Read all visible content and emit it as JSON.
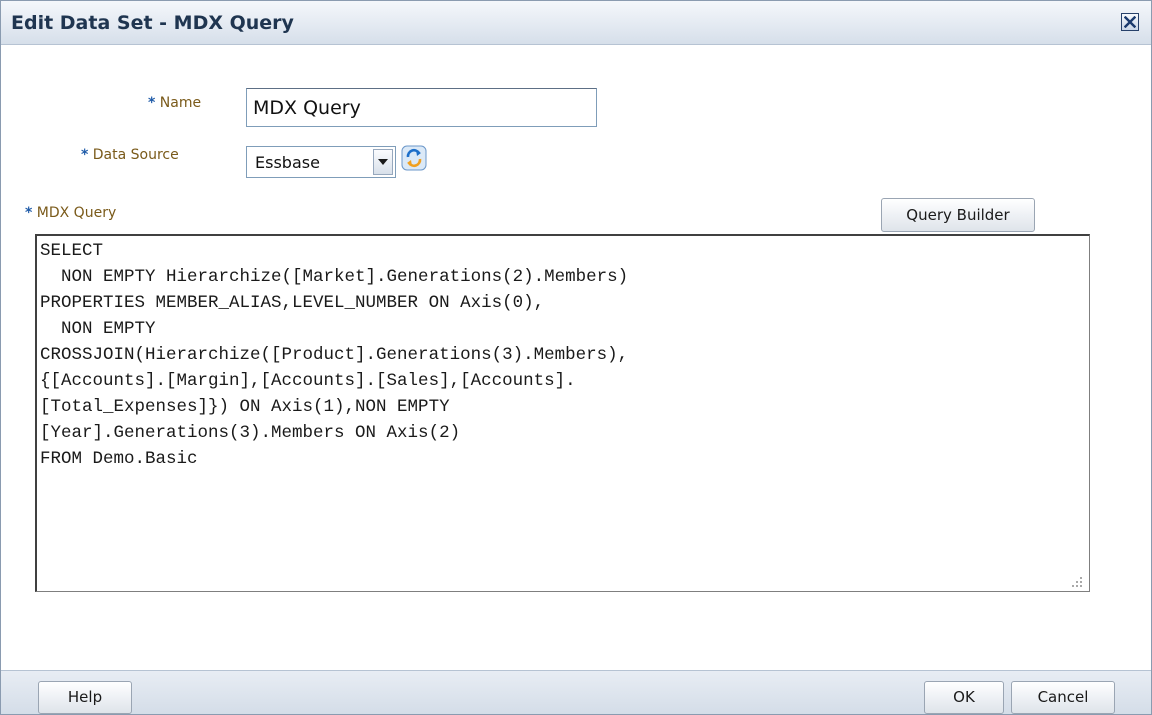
{
  "dialog": {
    "title": "Edit Data Set - MDX Query",
    "close_icon": "close-icon"
  },
  "form": {
    "required_marker": "*",
    "name_label": "Name",
    "name_value": "MDX Query",
    "data_source_label": "Data Source",
    "data_source_value": "Essbase",
    "refresh_icon": "refresh-icon",
    "mdx_query_label": "MDX Query",
    "query_builder_label": "Query Builder",
    "query_text": "SELECT\n  NON EMPTY Hierarchize([Market].Generations(2).Members)\nPROPERTIES MEMBER_ALIAS,LEVEL_NUMBER ON Axis(0),\n  NON EMPTY\nCROSSJOIN(Hierarchize([Product].Generations(3).Members),\n{[Accounts].[Margin],[Accounts].[Sales],[Accounts].\n[Total_Expenses]}) ON Axis(1),NON EMPTY\n[Year].Generations(3).Members ON Axis(2)\nFROM Demo.Basic"
  },
  "footer": {
    "help_label": "Help",
    "ok_label": "OK",
    "cancel_label": "Cancel"
  },
  "colors": {
    "label_text": "#7a5a1a",
    "required_marker": "#1f5ba8",
    "title_text": "#1f3550"
  }
}
